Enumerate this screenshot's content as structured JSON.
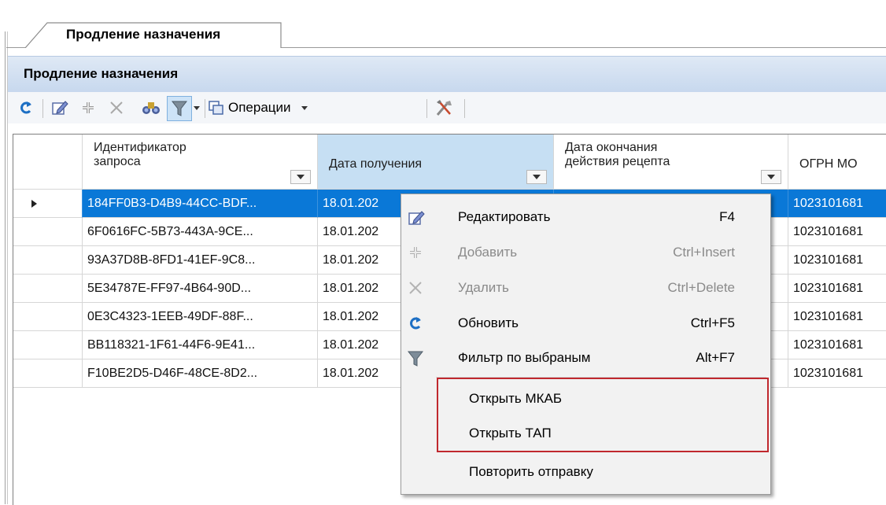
{
  "tab": {
    "label": "Продление назначения"
  },
  "panel": {
    "title": "Продление назначения"
  },
  "toolbar": {
    "operations_label": "Операции",
    "icons": [
      "refresh-icon",
      "edit-icon",
      "add-icon",
      "delete-icon",
      "find-icon",
      "filter-icon",
      "copy-icon",
      "tools-icon"
    ]
  },
  "grid": {
    "columns": [
      {
        "label": "Идентификатор\nзапроса"
      },
      {
        "label": "Дата получения"
      },
      {
        "label": "Дата окончания\nдействия рецепта"
      },
      {
        "label": "ОГРН МО"
      }
    ],
    "rows": [
      {
        "id": "184FF0B3-D4B9-44CC-BDF...",
        "date": "18.01.202",
        "ogrn": "1023101681",
        "selected": true
      },
      {
        "id": "6F0616FC-5B73-443A-9CE...",
        "date": "18.01.202",
        "ogrn": "1023101681"
      },
      {
        "id": "93A37D8B-8FD1-41EF-9C8...",
        "date": "18.01.202",
        "ogrn": "1023101681"
      },
      {
        "id": "5E34787E-FF97-4B64-90D...",
        "date": "18.01.202",
        "ogrn": "1023101681"
      },
      {
        "id": "0E3C4323-1EEB-49DF-88F...",
        "date": "18.01.202",
        "ogrn": "1023101681"
      },
      {
        "id": "BB118321-1F61-44F6-9E41...",
        "date": "18.01.202",
        "ogrn": "1023101681"
      },
      {
        "id": "F10BE2D5-D46F-48CE-8D2...",
        "date": "18.01.202",
        "ogrn": "1023101681"
      }
    ]
  },
  "context_menu": {
    "items": [
      {
        "label": "Редактировать",
        "shortcut": "F4"
      },
      {
        "label": "Добавить",
        "shortcut": "Ctrl+Insert",
        "disabled": true
      },
      {
        "label": "Удалить",
        "shortcut": "Ctrl+Delete",
        "disabled": true
      },
      {
        "label": "Обновить",
        "shortcut": "Ctrl+F5"
      },
      {
        "label": "Фильтр по выбраным",
        "shortcut": "Alt+F7"
      },
      {
        "label": "Открыть МКАБ"
      },
      {
        "label": "Открыть ТАП"
      },
      {
        "label": "Повторить отправку"
      }
    ],
    "highlight_color": "#c0282e"
  },
  "colors": {
    "selection": "#0a78d7",
    "header_highlight": "#c6dff3"
  }
}
